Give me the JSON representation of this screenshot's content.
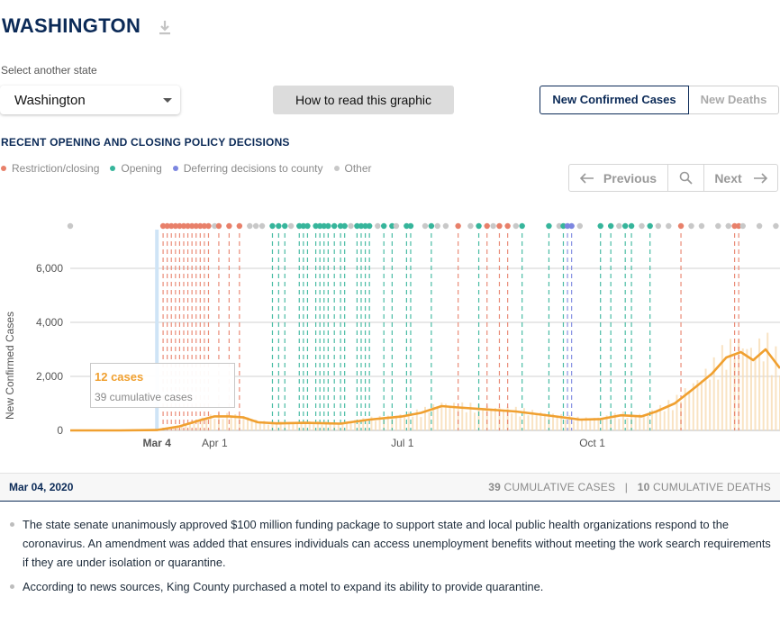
{
  "header": {
    "state_title": "WASHINGTON",
    "download_icon": "download-icon"
  },
  "controls": {
    "select_label": "Select another state",
    "selected_state": "Washington",
    "howto_label": "How to read this graphic",
    "metric_active": "New Confirmed Cases",
    "metric_inactive": "New Deaths"
  },
  "policy_section": {
    "heading": "RECENT OPENING AND CLOSING POLICY DECISIONS",
    "legend": [
      {
        "label": "Restriction/closing",
        "color": "#e8806a"
      },
      {
        "label": "Opening",
        "color": "#36b59b"
      },
      {
        "label": "Deferring decisions to county",
        "color": "#7c86e0"
      },
      {
        "label": "Other",
        "color": "#c8c8c8"
      }
    ]
  },
  "pager": {
    "prev_label": "Previous",
    "next_label": "Next",
    "search_icon": "search-icon"
  },
  "tooltip": {
    "cases": "12 cases",
    "cumulative": "39 cumulative cases"
  },
  "selected_day": {
    "date": "Mar 04, 2020",
    "cum_cases_value": "39",
    "cum_cases_label": "CUMULATIVE CASES",
    "cum_deaths_value": "10",
    "cum_deaths_label": "CUMULATIVE DEATHS"
  },
  "notes": [
    "The state senate unanimously approved $100 million funding package to support state and local public health organizations respond to the coronavirus. An amendment was added that ensures individuals can access unemployment benefits without meeting the work search requirements if they are under isolation or quarantine.",
    "According to news sources, King County purchased a motel to expand its ability to provide quarantine."
  ],
  "chart_data": {
    "type": "line",
    "ylabel": "New Confirmed Cases",
    "ylim": [
      0,
      6000
    ],
    "yticks": [
      0,
      2000,
      4000,
      6000
    ],
    "ytick_labels": [
      "0",
      "2,000",
      "4,000",
      "6,000"
    ],
    "xlim": [
      "2020-01-22",
      "2020-12-31"
    ],
    "xticks": [
      {
        "date": "2020-03-04",
        "label": "Mar 4",
        "highlight": true
      },
      {
        "date": "2020-04-01",
        "label": "Apr 1",
        "highlight": false
      },
      {
        "date": "2020-07-01",
        "label": "Jul 1",
        "highlight": false
      },
      {
        "date": "2020-10-01",
        "label": "Oct 1",
        "highlight": false
      }
    ],
    "selected_date": "2020-03-04",
    "series": [
      {
        "color": "#f0a030",
        "x": [
          "2020-01-22",
          "2020-02-15",
          "2020-03-04",
          "2020-03-15",
          "2020-03-25",
          "2020-04-01",
          "2020-04-08",
          "2020-04-15",
          "2020-04-22",
          "2020-05-01",
          "2020-05-15",
          "2020-06-01",
          "2020-06-15",
          "2020-07-01",
          "2020-07-10",
          "2020-07-20",
          "2020-07-28",
          "2020-08-10",
          "2020-08-25",
          "2020-09-10",
          "2020-09-25",
          "2020-10-05",
          "2020-10-15",
          "2020-10-25",
          "2020-11-01",
          "2020-11-10",
          "2020-11-20",
          "2020-11-28",
          "2020-12-05",
          "2020-12-12",
          "2020-12-18",
          "2020-12-24",
          "2020-12-31"
        ],
        "values": [
          0,
          0,
          12,
          150,
          380,
          520,
          520,
          480,
          300,
          260,
          280,
          250,
          400,
          520,
          650,
          900,
          850,
          780,
          700,
          550,
          400,
          420,
          560,
          520,
          700,
          1000,
          1600,
          2100,
          2700,
          2900,
          2600,
          3000,
          2300
        ]
      }
    ],
    "daily_bars_color": "#f8dcb4",
    "policy_events": [
      {
        "date": "2020-01-22",
        "kind": "other"
      },
      {
        "date": "2020-03-07",
        "kind": "restriction"
      },
      {
        "date": "2020-03-09",
        "kind": "restriction"
      },
      {
        "date": "2020-03-11",
        "kind": "restriction"
      },
      {
        "date": "2020-03-13",
        "kind": "restriction"
      },
      {
        "date": "2020-03-15",
        "kind": "restriction"
      },
      {
        "date": "2020-03-17",
        "kind": "restriction"
      },
      {
        "date": "2020-03-19",
        "kind": "restriction"
      },
      {
        "date": "2020-03-21",
        "kind": "restriction"
      },
      {
        "date": "2020-03-23",
        "kind": "restriction"
      },
      {
        "date": "2020-03-25",
        "kind": "restriction"
      },
      {
        "date": "2020-03-27",
        "kind": "restriction"
      },
      {
        "date": "2020-03-29",
        "kind": "restriction"
      },
      {
        "date": "2020-04-01",
        "kind": "other"
      },
      {
        "date": "2020-04-03",
        "kind": "restriction"
      },
      {
        "date": "2020-04-08",
        "kind": "restriction"
      },
      {
        "date": "2020-04-13",
        "kind": "restriction"
      },
      {
        "date": "2020-04-18",
        "kind": "other"
      },
      {
        "date": "2020-04-21",
        "kind": "other"
      },
      {
        "date": "2020-04-24",
        "kind": "other"
      },
      {
        "date": "2020-04-29",
        "kind": "opening"
      },
      {
        "date": "2020-05-02",
        "kind": "opening"
      },
      {
        "date": "2020-05-05",
        "kind": "opening"
      },
      {
        "date": "2020-05-08",
        "kind": "other"
      },
      {
        "date": "2020-05-12",
        "kind": "opening"
      },
      {
        "date": "2020-05-14",
        "kind": "opening"
      },
      {
        "date": "2020-05-16",
        "kind": "opening"
      },
      {
        "date": "2020-05-20",
        "kind": "opening"
      },
      {
        "date": "2020-05-22",
        "kind": "opening"
      },
      {
        "date": "2020-05-24",
        "kind": "opening"
      },
      {
        "date": "2020-05-26",
        "kind": "opening"
      },
      {
        "date": "2020-05-29",
        "kind": "opening"
      },
      {
        "date": "2020-06-01",
        "kind": "opening"
      },
      {
        "date": "2020-06-03",
        "kind": "opening"
      },
      {
        "date": "2020-06-06",
        "kind": "other"
      },
      {
        "date": "2020-06-09",
        "kind": "opening"
      },
      {
        "date": "2020-06-11",
        "kind": "opening"
      },
      {
        "date": "2020-06-13",
        "kind": "opening"
      },
      {
        "date": "2020-06-15",
        "kind": "opening"
      },
      {
        "date": "2020-06-19",
        "kind": "other"
      },
      {
        "date": "2020-06-22",
        "kind": "opening"
      },
      {
        "date": "2020-06-26",
        "kind": "opening"
      },
      {
        "date": "2020-06-28",
        "kind": "other"
      },
      {
        "date": "2020-07-03",
        "kind": "opening"
      },
      {
        "date": "2020-07-05",
        "kind": "opening"
      },
      {
        "date": "2020-07-12",
        "kind": "other"
      },
      {
        "date": "2020-07-15",
        "kind": "opening"
      },
      {
        "date": "2020-07-18",
        "kind": "other"
      },
      {
        "date": "2020-07-22",
        "kind": "other"
      },
      {
        "date": "2020-07-28",
        "kind": "restriction"
      },
      {
        "date": "2020-08-03",
        "kind": "other"
      },
      {
        "date": "2020-08-07",
        "kind": "opening"
      },
      {
        "date": "2020-08-11",
        "kind": "restriction"
      },
      {
        "date": "2020-08-14",
        "kind": "other"
      },
      {
        "date": "2020-08-17",
        "kind": "restriction"
      },
      {
        "date": "2020-08-21",
        "kind": "restriction"
      },
      {
        "date": "2020-08-25",
        "kind": "other"
      },
      {
        "date": "2020-08-28",
        "kind": "opening"
      },
      {
        "date": "2020-09-10",
        "kind": "opening"
      },
      {
        "date": "2020-09-15",
        "kind": "other"
      },
      {
        "date": "2020-09-17",
        "kind": "opening"
      },
      {
        "date": "2020-09-19",
        "kind": "county"
      },
      {
        "date": "2020-09-21",
        "kind": "county"
      },
      {
        "date": "2020-09-25",
        "kind": "other"
      },
      {
        "date": "2020-10-05",
        "kind": "opening"
      },
      {
        "date": "2020-10-10",
        "kind": "opening"
      },
      {
        "date": "2020-10-14",
        "kind": "other"
      },
      {
        "date": "2020-10-17",
        "kind": "opening"
      },
      {
        "date": "2020-10-20",
        "kind": "opening"
      },
      {
        "date": "2020-10-25",
        "kind": "other"
      },
      {
        "date": "2020-10-29",
        "kind": "opening"
      },
      {
        "date": "2020-11-02",
        "kind": "other"
      },
      {
        "date": "2020-11-07",
        "kind": "other"
      },
      {
        "date": "2020-11-13",
        "kind": "restriction"
      },
      {
        "date": "2020-11-18",
        "kind": "other"
      },
      {
        "date": "2020-11-23",
        "kind": "other"
      },
      {
        "date": "2020-12-01",
        "kind": "other"
      },
      {
        "date": "2020-12-06",
        "kind": "other"
      },
      {
        "date": "2020-12-09",
        "kind": "restriction"
      },
      {
        "date": "2020-12-11",
        "kind": "restriction"
      },
      {
        "date": "2020-12-13",
        "kind": "other"
      },
      {
        "date": "2020-12-21",
        "kind": "other"
      },
      {
        "date": "2020-12-29",
        "kind": "other"
      }
    ]
  }
}
